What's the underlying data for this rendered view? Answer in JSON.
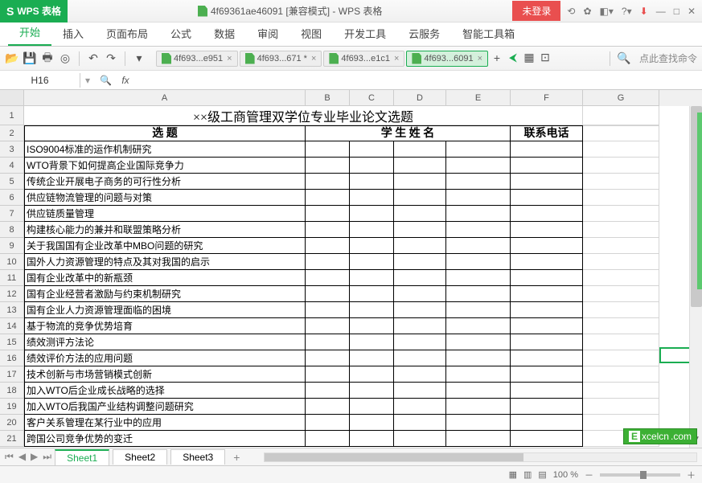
{
  "app": {
    "brand": "WPS 表格",
    "title": "4f69361ae46091 [兼容模式] - WPS 表格",
    "login": "未登录"
  },
  "menu": [
    "开始",
    "插入",
    "页面布局",
    "公式",
    "数据",
    "审阅",
    "视图",
    "开发工具",
    "云服务",
    "智能工具箱"
  ],
  "docTabs": [
    {
      "label": "4f693...e951",
      "active": false,
      "mod": ""
    },
    {
      "label": "4f693...671",
      "active": false,
      "mod": " *"
    },
    {
      "label": "4f693...e1c1",
      "active": false,
      "mod": ""
    },
    {
      "label": "4f693...6091",
      "active": true,
      "mod": ""
    }
  ],
  "searchPlaceholder": "点此查找命令",
  "namebox": "H16",
  "cols": [
    "A",
    "B",
    "C",
    "D",
    "E",
    "F",
    "G"
  ],
  "rowCount": 21,
  "title": "××级工商管理双学位专业毕业论文选题",
  "headers": {
    "topic": "选  题",
    "student": "学  生  姓  名",
    "phone": "联系电话"
  },
  "topics": [
    "ISO9004标准的运作机制研究",
    "WTO背景下如何提高企业国际竞争力",
    "传统企业开展电子商务的可行性分析",
    "供应链物流管理的问题与对策",
    "供应链质量管理",
    "构建核心能力的兼并和联盟策略分析",
    "关于我国国有企业改革中MBO问题的研究",
    "国外人力资源管理的特点及其对我国的启示",
    "国有企业改革中的新瓶颈",
    "国有企业经营者激励与约束机制研究",
    "国有企业人力资源管理面临的困境",
    "基于物流的竞争优势培育",
    "绩效测评方法论",
    "绩效评价方法的应用问题",
    "技术创新与市场营销模式创新",
    "加入WTO后企业成长战略的选择",
    "加入WTO后我国产业结构调整问题研究",
    "客户关系管理在某行业中的应用",
    "跨国公司竞争优势的变迁"
  ],
  "sheets": [
    "Sheet1",
    "Sheet2",
    "Sheet3"
  ],
  "status": {
    "zoom": "100 %"
  },
  "watermark": {
    "E": "E",
    "text": "xcelcn",
    "suffix": ".com"
  }
}
